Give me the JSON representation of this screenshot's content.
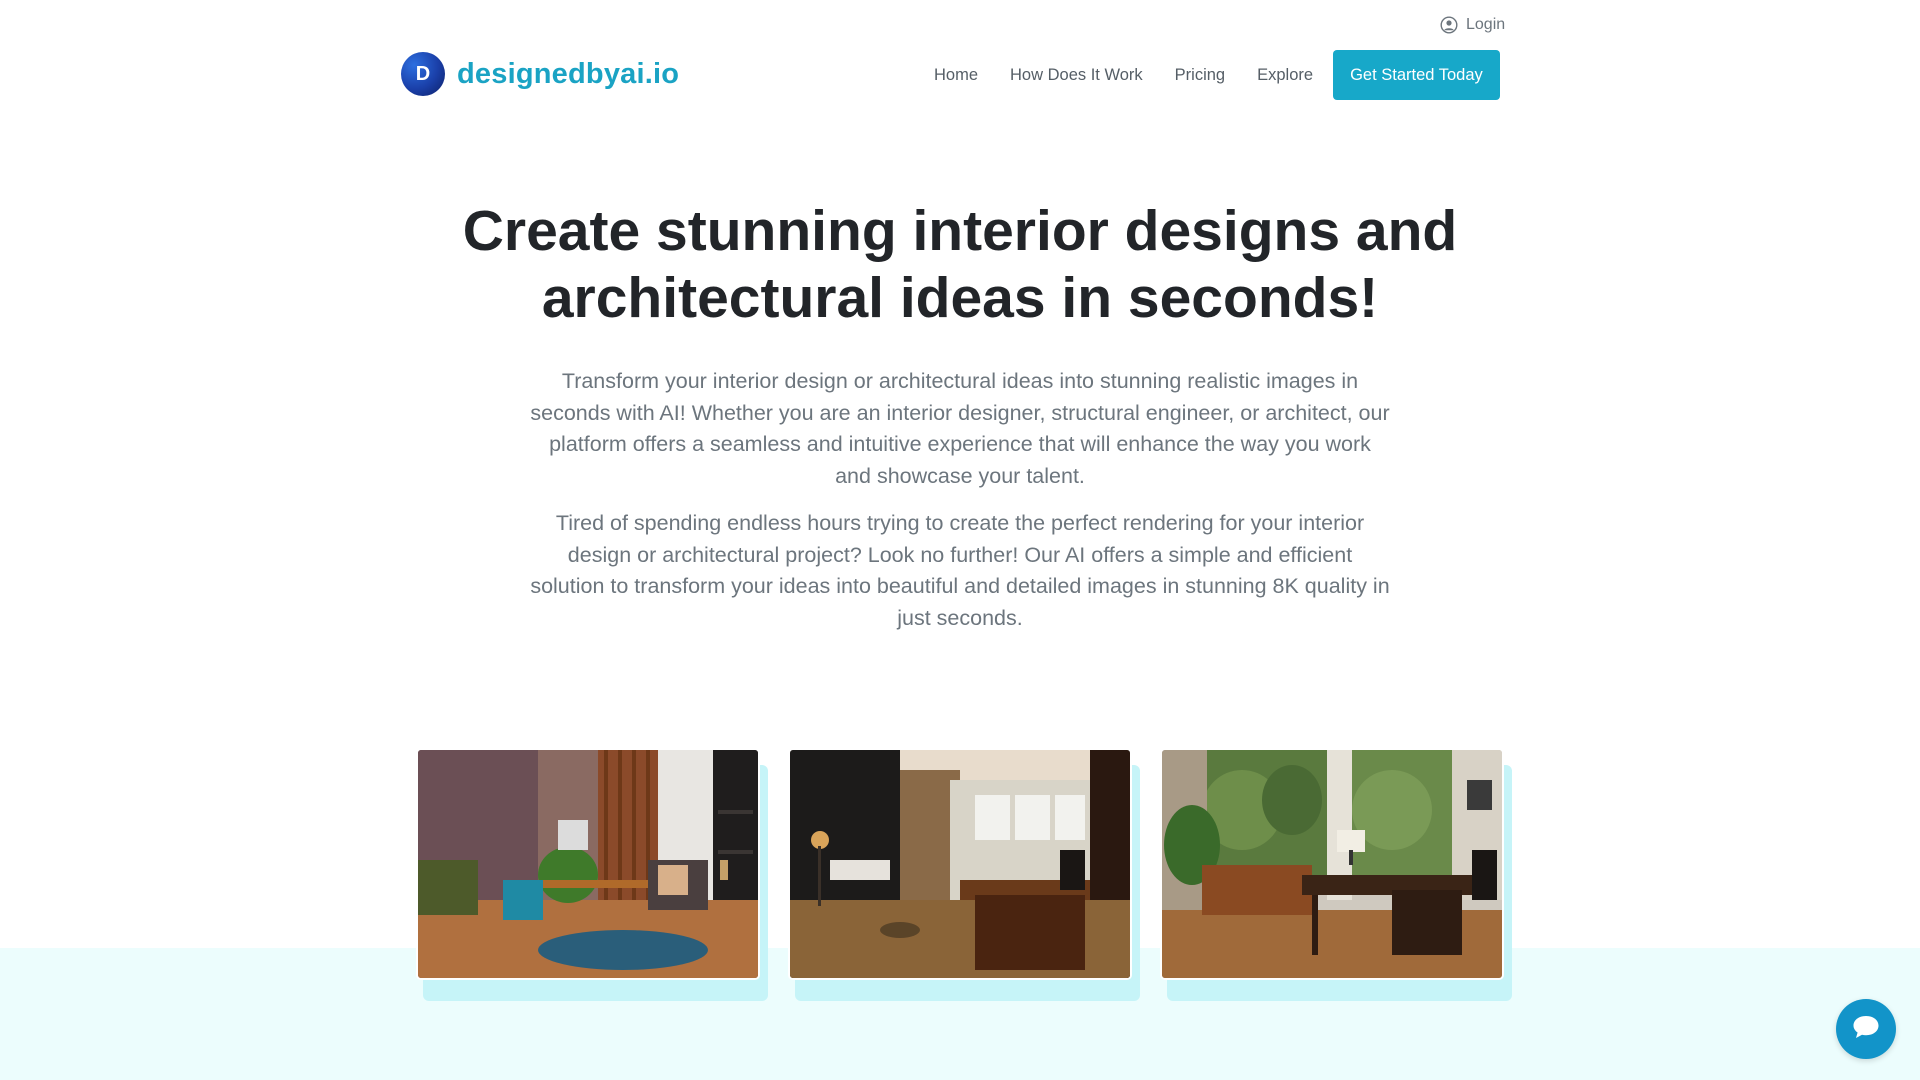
{
  "header": {
    "login_label": "Login",
    "brand_letter": "D",
    "brand_name": "designedbyai.io",
    "nav": [
      "Home",
      "How Does It Work",
      "Pricing",
      "Explore"
    ],
    "cta_label": "Get Started Today"
  },
  "hero": {
    "title": "Create stunning interior designs and architectural ideas in seconds!",
    "paragraph_1": "Transform your interior design or architectural ideas into stunning realistic images in seconds with AI! Whether you are an interior designer, structural engineer, or architect, our platform offers a seamless and intuitive experience that will enhance the way you work and showcase your talent.",
    "paragraph_2": "Tired of spending endless hours trying to create the perfect rendering for your interior design or architectural project? Look no further! Our AI offers a simple and efficient solution to transform your ideas into beautiful and detailed images in stunning 8K quality in just seconds."
  },
  "gallery": [
    {
      "icon": "office-render-image"
    },
    {
      "icon": "office-render-image"
    },
    {
      "icon": "office-render-image"
    }
  ],
  "chat": {
    "icon": "chat-icon"
  },
  "colors": {
    "brand": "#1aa3c4",
    "cta": "#17a8c9",
    "band": "#ecfdfd",
    "plate": "#c6f4f8",
    "chat": "#1294c9"
  }
}
